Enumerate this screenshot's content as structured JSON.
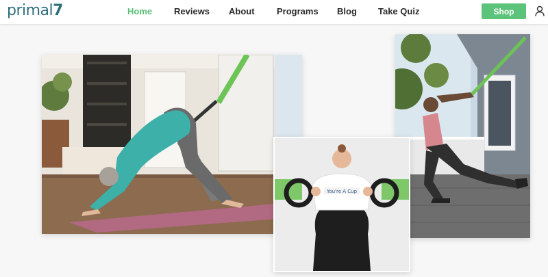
{
  "brand": {
    "name": "primal",
    "number": "7",
    "color": "#2f6f7c"
  },
  "nav": {
    "items": [
      {
        "label": "Home",
        "active": true
      },
      {
        "label": "Reviews",
        "active": false
      },
      {
        "label": "About",
        "active": false
      },
      {
        "label": "Programs",
        "active": false
      },
      {
        "label": "Blog",
        "active": false
      },
      {
        "label": "Take Quiz",
        "active": false
      }
    ],
    "active_color": "#5cbf77"
  },
  "header": {
    "shop_label": "Shop",
    "shop_color": "#5cc37a",
    "account_icon": "user-icon"
  },
  "hero": {
    "photos": [
      {
        "name": "woman-downward-dog-strap"
      },
      {
        "name": "man-lunge-deck-strap"
      },
      {
        "name": "woman-resistance-handles"
      }
    ],
    "shirt_text": "You're A Cup"
  }
}
